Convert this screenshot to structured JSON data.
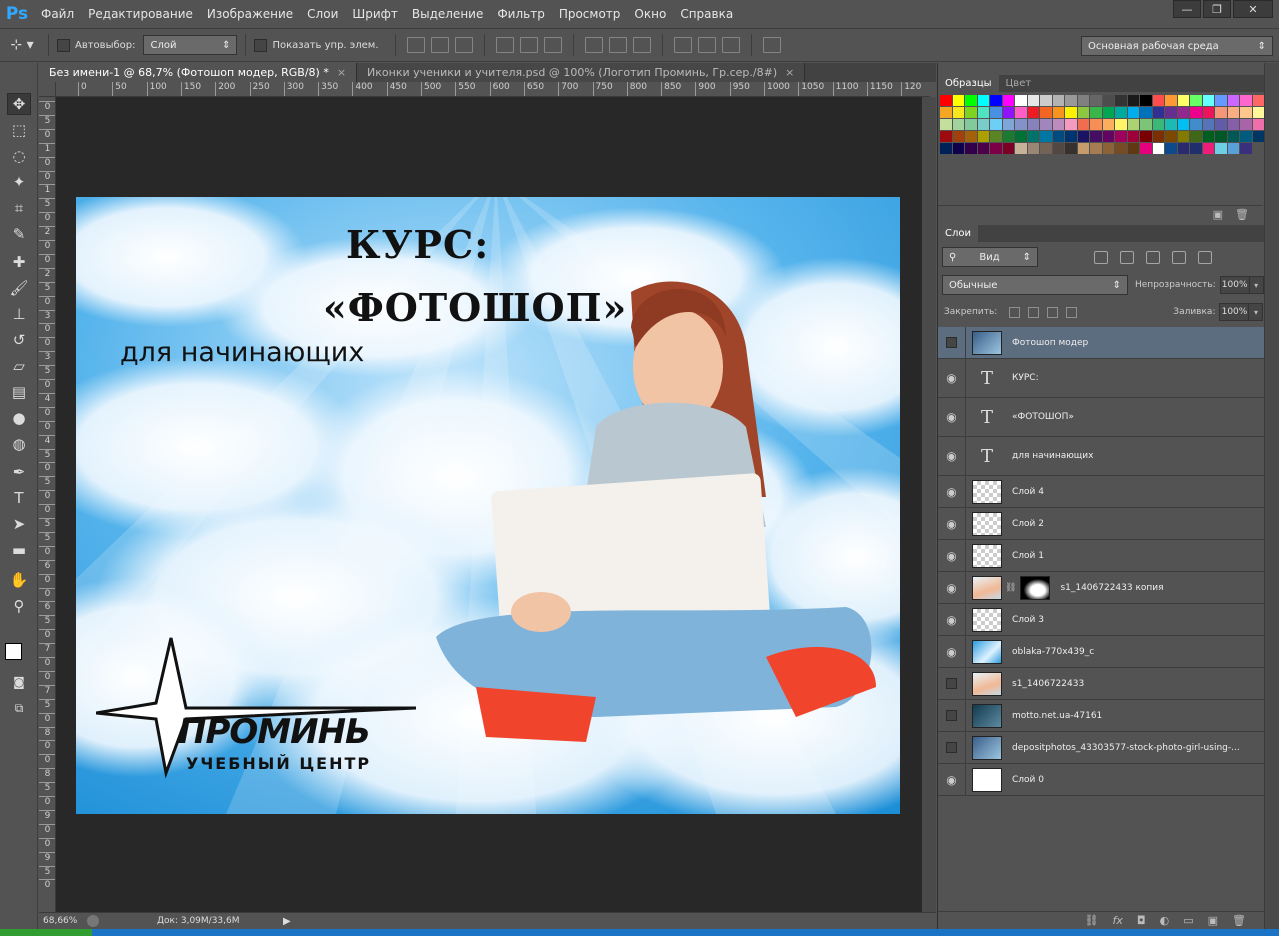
{
  "app": {
    "logo": "Ps"
  },
  "menu": [
    "Файл",
    "Редактирование",
    "Изображение",
    "Слои",
    "Шрифт",
    "Выделение",
    "Фильтр",
    "Просмотр",
    "Окно",
    "Справка"
  ],
  "window_controls": {
    "minimize": "—",
    "restore": "❐",
    "close": "✕"
  },
  "options": {
    "autoselect_label": "Автовыбор:",
    "autoselect_value": "Слой",
    "show_transform_label": "Показать упр. элем.",
    "workspace": "Основная рабочая среда"
  },
  "tabs": [
    {
      "label": "Без имени-1 @ 68,7% (Фотошоп модер, RGB/8) *",
      "close": "×"
    },
    {
      "label": "Иконки ученики и учителя.psd @ 100% (Логотип Проминь, Гр.сер./8#)",
      "close": "×"
    }
  ],
  "ruler_h": [
    "0",
    "50",
    "100",
    "150",
    "200",
    "250",
    "300",
    "350",
    "400",
    "450",
    "500",
    "550",
    "600",
    "650",
    "700",
    "750",
    "800",
    "850",
    "900",
    "950",
    "1000",
    "1050",
    "1100",
    "1150",
    "120"
  ],
  "ruler_v": [
    "0",
    "5",
    "0",
    "1",
    "0",
    "0",
    "1",
    "5",
    "0",
    "2",
    "0",
    "0",
    "2",
    "5",
    "0",
    "3",
    "0",
    "0",
    "3",
    "5",
    "0",
    "4",
    "0",
    "0",
    "4",
    "5",
    "0",
    "5",
    "0",
    "0",
    "5",
    "5",
    "0",
    "6",
    "0",
    "0",
    "6",
    "5",
    "0",
    "7",
    "0",
    "0",
    "7",
    "5",
    "0",
    "8",
    "0",
    "0",
    "8",
    "5",
    "0",
    "9",
    "0",
    "0",
    "9",
    "5",
    "0"
  ],
  "document": {
    "title_line1": "КУРС:",
    "title_line2": "«ФОТОШОП»",
    "subtitle": "для начинающих",
    "logo_name": "ПРОМИНЬ",
    "logo_sub": "УЧЕБНЫЙ ЦЕНТР",
    "colors": {
      "sky": "#2e9ee0",
      "cloud": "#f4fbff",
      "text": "#111111",
      "laptop": "#f4f0ec",
      "jeans": "#7fb3d9",
      "shoes": "#f0452c",
      "hair": "#a0452a",
      "skin": "#f2c4a6"
    }
  },
  "status": {
    "zoom": "68,66%",
    "doc_size": "Док: 3,09M/33,6M",
    "arrow": "▶"
  },
  "swatches": {
    "tabs": [
      "Образцы",
      "Цвет"
    ],
    "colors": [
      "#ff0000",
      "#ffff00",
      "#00ff00",
      "#00ffff",
      "#0000ff",
      "#ff00ff",
      "#ffffff",
      "#e6e6e6",
      "#cccccc",
      "#b3b3b3",
      "#999999",
      "#808080",
      "#666666",
      "#4d4d4d",
      "#333333",
      "#1a1a1a",
      "#000000",
      "#ff4d4d",
      "#ff9933",
      "#ffff66",
      "#66ff66",
      "#66ffff",
      "#6699ff",
      "#cc66ff",
      "#ff66cc",
      "#ff6666",
      "#f5a623",
      "#f8e71c",
      "#7ed321",
      "#50e3c2",
      "#4a90e2",
      "#9013fe",
      "#ff5ec4",
      "#ed1c24",
      "#f26522",
      "#f7941d",
      "#fff200",
      "#8dc63f",
      "#39b54a",
      "#00a651",
      "#00a99d",
      "#00aeef",
      "#0072bc",
      "#2e3192",
      "#662d91",
      "#92278f",
      "#ec008c",
      "#ed145b",
      "#f69679",
      "#f9ad81",
      "#fdc68a",
      "#fff799",
      "#c4df9b",
      "#a3d39c",
      "#82ca9c",
      "#7accc8",
      "#6dcff6",
      "#7da7d9",
      "#8393ca",
      "#8781bd",
      "#a186be",
      "#bd8cbf",
      "#f49ac1",
      "#f26c4f",
      "#f68e55",
      "#fbaf5d",
      "#fff467",
      "#acd372",
      "#7cc576",
      "#3bb878",
      "#1abbb4",
      "#00bff3",
      "#438ccb",
      "#5574b9",
      "#605ca8",
      "#855fa8",
      "#a864a8",
      "#f06eaa",
      "#9e0b0f",
      "#a0410d",
      "#a3620a",
      "#aba000",
      "#598527",
      "#1a7b30",
      "#007236",
      "#00746b",
      "#0076a3",
      "#004b80",
      "#003471",
      "#1b1464",
      "#440e62",
      "#630460",
      "#9e005d",
      "#9e0039",
      "#790000",
      "#7b2e00",
      "#7d4900",
      "#827b00",
      "#406618",
      "#005e20",
      "#005826",
      "#005952",
      "#005b7f",
      "#003663",
      "#002157",
      "#0d004c",
      "#32004b",
      "#4b0049",
      "#7b0046",
      "#7a0026",
      "#c7b299",
      "#998675",
      "#736357",
      "#534741",
      "#37302d",
      "#c69c6d",
      "#a67c52",
      "#8c6239",
      "#754c24",
      "#603913",
      "#e5007e",
      "#ffffff",
      "#0d4a8c",
      "#2a2a6e",
      "#1f2f6b",
      "#ed1e79",
      "#6ccfe3",
      "#5aa0d8",
      "#3a2f7a"
    ]
  },
  "layers_panel": {
    "tab": "Слои",
    "filter": "Вид",
    "blend_mode": "Обычные",
    "opacity_label": "Непрозрачность:",
    "opacity": "100%",
    "lock_label": "Закрепить:",
    "fill_label": "Заливка:",
    "fill": "100%",
    "layers": [
      {
        "name": "Фотошоп модер",
        "kind": "smart",
        "visible": false,
        "selected": true
      },
      {
        "name": "КУРС:",
        "kind": "text",
        "visible": true
      },
      {
        "name": "«ФОТОШОП»",
        "kind": "text",
        "visible": true
      },
      {
        "name": "для начинающих",
        "kind": "text",
        "visible": true
      },
      {
        "name": "Слой 4",
        "kind": "checker",
        "visible": true
      },
      {
        "name": "Слой 2",
        "kind": "checker",
        "visible": true
      },
      {
        "name": "Слой 1",
        "kind": "checker",
        "visible": true
      },
      {
        "name": "s1_1406722433 копия",
        "kind": "photo-mask",
        "visible": true
      },
      {
        "name": "Слой 3",
        "kind": "checker",
        "visible": true
      },
      {
        "name": "oblaka-770x439_c",
        "kind": "sky",
        "visible": true
      },
      {
        "name": "s1_1406722433",
        "kind": "photo",
        "visible": false
      },
      {
        "name": "motto.net.ua-47161",
        "kind": "dark",
        "visible": false
      },
      {
        "name": "depositphotos_43303577-stock-photo-girl-using-...",
        "kind": "smart2",
        "visible": false
      },
      {
        "name": "Слой 0",
        "kind": "white",
        "visible": true
      }
    ],
    "footer_icons": [
      "link-icon",
      "fx-icon",
      "mask-icon",
      "adjustment-icon",
      "group-icon",
      "new-layer-icon",
      "trash-icon"
    ]
  }
}
